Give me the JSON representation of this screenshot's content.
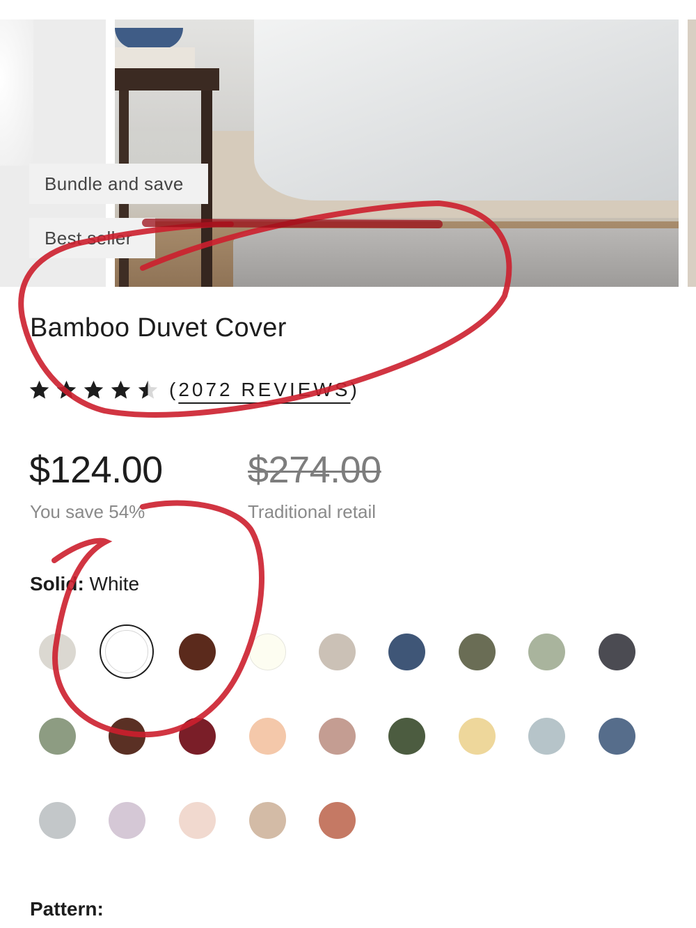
{
  "gallery": {
    "badges": [
      "Bundle and save",
      "Best seller"
    ]
  },
  "product": {
    "title": "Bamboo Duvet Cover",
    "rating": 4.5,
    "reviews_text": "2072 REVIEWS",
    "price": "$124.00",
    "price_note": "You save 54%",
    "original_price": "$274.00",
    "original_note": "Traditional retail"
  },
  "options": {
    "color_group_label": "Solid:",
    "selected_color": "White",
    "pattern_label": "Pattern:"
  },
  "swatch_colors": [
    [
      "#dbd8d1",
      "#ffffff",
      "#5b2a1c",
      "#fdfdf1",
      "#cbc1b6",
      "#3f5677",
      "#6a6d55",
      "#a9b49d",
      "#4b4b52"
    ],
    [
      "#8d9c82",
      "#5a3024",
      "#7a1e28",
      "#f4c8aa",
      "#c49d92",
      "#4c5c40",
      "#eed79b",
      "#b6c4c9",
      "#566d8b"
    ],
    [
      "#c3c7c9",
      "#d5c8d6",
      "#f1d9cf",
      "#d3bba6",
      "#c57964"
    ]
  ],
  "theme": {
    "text": "#1d1d1d",
    "muted": "#8a8a8a",
    "annotation": "#cc1f2e"
  }
}
